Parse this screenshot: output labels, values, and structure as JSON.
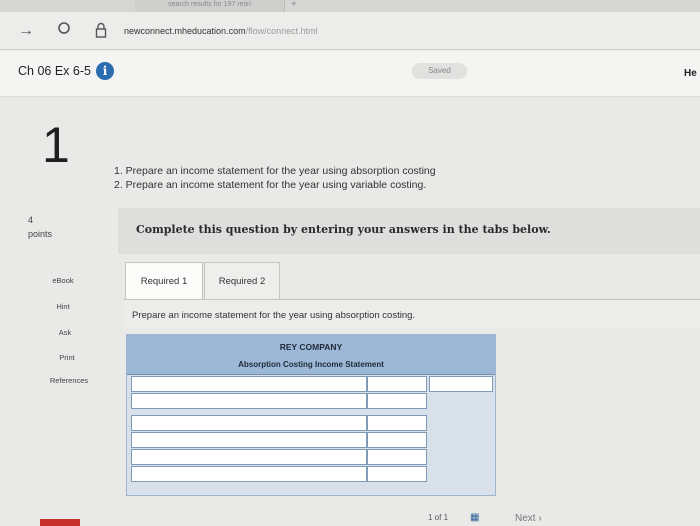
{
  "browser": {
    "tab_title": "search results for 197 retiri",
    "new_tab_symbol": "+",
    "url_domain": "newconnect.mheducation.com",
    "url_path": "/flow/connect.html"
  },
  "header": {
    "chapter_title": "Ch 06 Ex 6-5",
    "saved_label": "Saved",
    "help_label": "He"
  },
  "question": {
    "number": "1",
    "points_value": "4",
    "points_label": "points",
    "instructions": [
      "1. Prepare an income statement for the year using absorption costing",
      "2. Prepare an income statement for the year using variable costing."
    ],
    "complete_prompt": "Complete this question by entering your answers in the tabs below."
  },
  "rail": {
    "ebook": "eBook",
    "hint": "Hint",
    "ask": "Ask",
    "print": "Print",
    "references": "References"
  },
  "tabs": [
    {
      "label": "Required 1",
      "active": true
    },
    {
      "label": "Required 2",
      "active": false
    }
  ],
  "tab_prompt": "Prepare an income statement for the year using absorption costing.",
  "statement": {
    "company": "REY COMPANY",
    "title": "Absorption Costing Income Statement"
  },
  "footer": {
    "pager": "1 of 1",
    "next_label": "Next"
  },
  "colors": {
    "info_blue": "#2b6cb0",
    "table_header": "#9db8d6",
    "footer_red": "#c7312b"
  },
  "icons": {
    "forward": "forward-arrow-icon",
    "refresh": "refresh-icon",
    "lock": "lock-icon",
    "info": "info-icon",
    "grid": "grid-icon"
  }
}
